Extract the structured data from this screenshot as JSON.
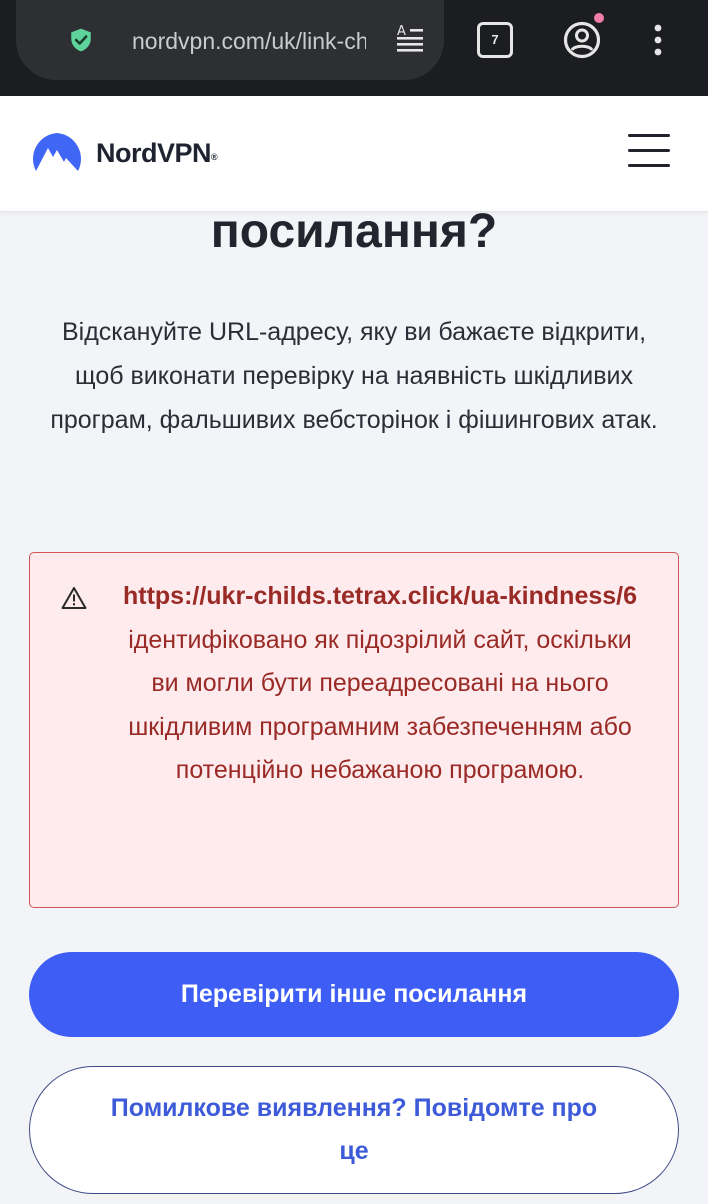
{
  "browser": {
    "url": "nordvpn.com/uk/link-checker",
    "tab_count": "7",
    "icons": {
      "security": "shield-check-icon",
      "reader": "reader-mode-icon",
      "account": "account-icon",
      "menu": "more-vert-icon"
    }
  },
  "header": {
    "brand": "NordVPN",
    "trademark": "®",
    "menu_icon": "hamburger-icon"
  },
  "main": {
    "heading": "посилання?",
    "intro": "Відскануйте URL-адресу, яку ви бажаєте відкрити, щоб виконати перевірку на наявність шкідливих програм, фальшивих вебсторінок і фішингових атак.",
    "alert": {
      "icon": "warning-triangle-icon",
      "url": "https://ukr-childs.tetrax.click/ua-kindness/6",
      "message": " ідентифіковано як підозрілий сайт, оскільки ви могли бути переадресовані на нього шкідливим програмним забезпеченням або потенційно небажаною програмою."
    },
    "primary_button": "Перевірити інше посилання",
    "secondary_button": "Помилкове виявлення? Повідомте про це"
  },
  "colors": {
    "accent": "#3d5df4",
    "alert_bg": "#fdebee",
    "alert_border": "#d15656",
    "alert_text": "#9a2a25",
    "page_bg": "#f3f4f8"
  }
}
